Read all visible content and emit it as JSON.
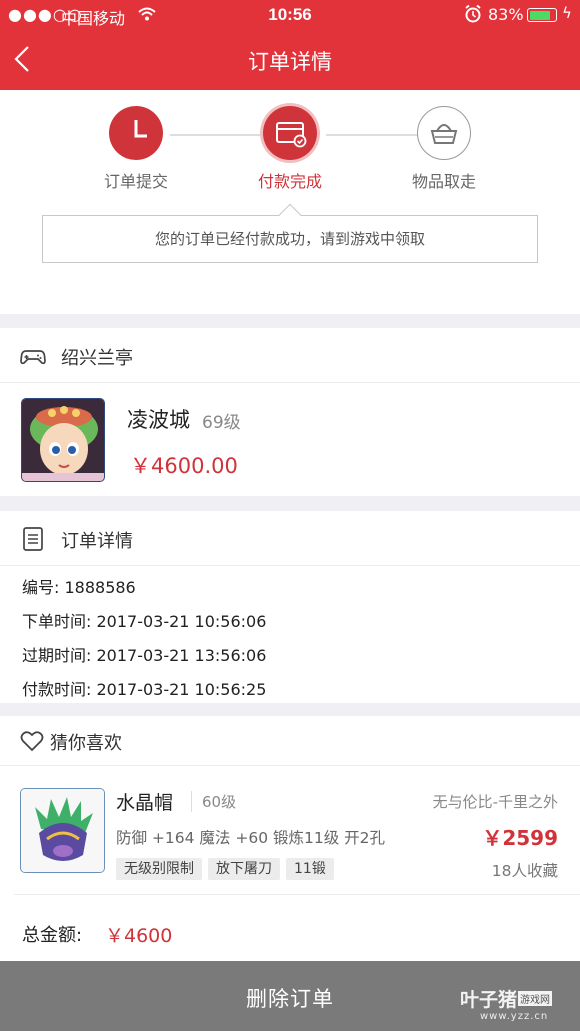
{
  "status_bar": {
    "carrier": "中国移动",
    "time": "10:56",
    "battery": "83%",
    "battery_level": 0.83
  },
  "nav": {
    "title": "订单详情"
  },
  "steps": [
    {
      "label": "订单提交",
      "icon": "clock-icon"
    },
    {
      "label": "付款完成",
      "icon": "card-check-icon"
    },
    {
      "label": "物品取走",
      "icon": "basket-icon"
    }
  ],
  "tip": "您的订单已经付款成功，请到游戏中领取",
  "server": {
    "name": "绍兴兰亭",
    "character": "凌波城",
    "level": "69级",
    "price": "￥4600.00"
  },
  "order": {
    "title": "订单详情",
    "number": "编号: 1888586",
    "order_time": "下单时间: 2017-03-21 10:56:06",
    "expire_time": "过期时间: 2017-03-21 13:56:06",
    "pay_time": "付款时间: 2017-03-21 10:56:25"
  },
  "recommend": {
    "title": "猜你喜欢",
    "item": {
      "name": "水晶帽",
      "level": "60级",
      "server": "无与伦比-千里之外",
      "stats": "防御 +164 魔法 +60 锻炼11级 开2孔",
      "price": "￥2599",
      "tags": [
        "无级别限制",
        "放下屠刀",
        "11锻"
      ],
      "favorites": "18人收藏"
    }
  },
  "total": {
    "label": "总金额:",
    "amount": "￥4600"
  },
  "delete_button": "删除订单",
  "watermark": {
    "brand": "叶子猪",
    "sub": "游戏网",
    "url": "www.yzz.cn"
  },
  "colors": {
    "accent": "#e2323a",
    "price": "#d0343b",
    "bottom_bar": "#7a7a7a"
  }
}
